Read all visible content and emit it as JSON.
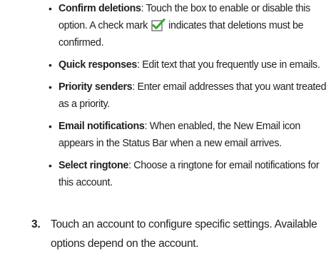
{
  "bullets": [
    {
      "term": "Confirm deletions",
      "text_before": ": Touch the box to enable or disable this option. A check mark ",
      "icon": "checkbox-checked-icon",
      "text_after": " indicates that deletions must be confirmed."
    },
    {
      "term": "Quick responses",
      "text": ": Edit text that you frequently use in emails."
    },
    {
      "term": "Priority senders",
      "text": ": Enter email addresses that you want treated as a priority."
    },
    {
      "term": "Email notifications",
      "text": ": When enabled, the New Email icon appears in the Status Bar when a new email arrives."
    },
    {
      "term": "Select ringtone",
      "text": ": Choose a ringtone for email notifications for this account."
    }
  ],
  "step": {
    "number": "3.",
    "text": "Touch an account to configure specific settings. Available options depend on the account."
  },
  "colors": {
    "text": "#231f20",
    "check_green": "#3aa935",
    "box_border": "#5a5a5a"
  }
}
